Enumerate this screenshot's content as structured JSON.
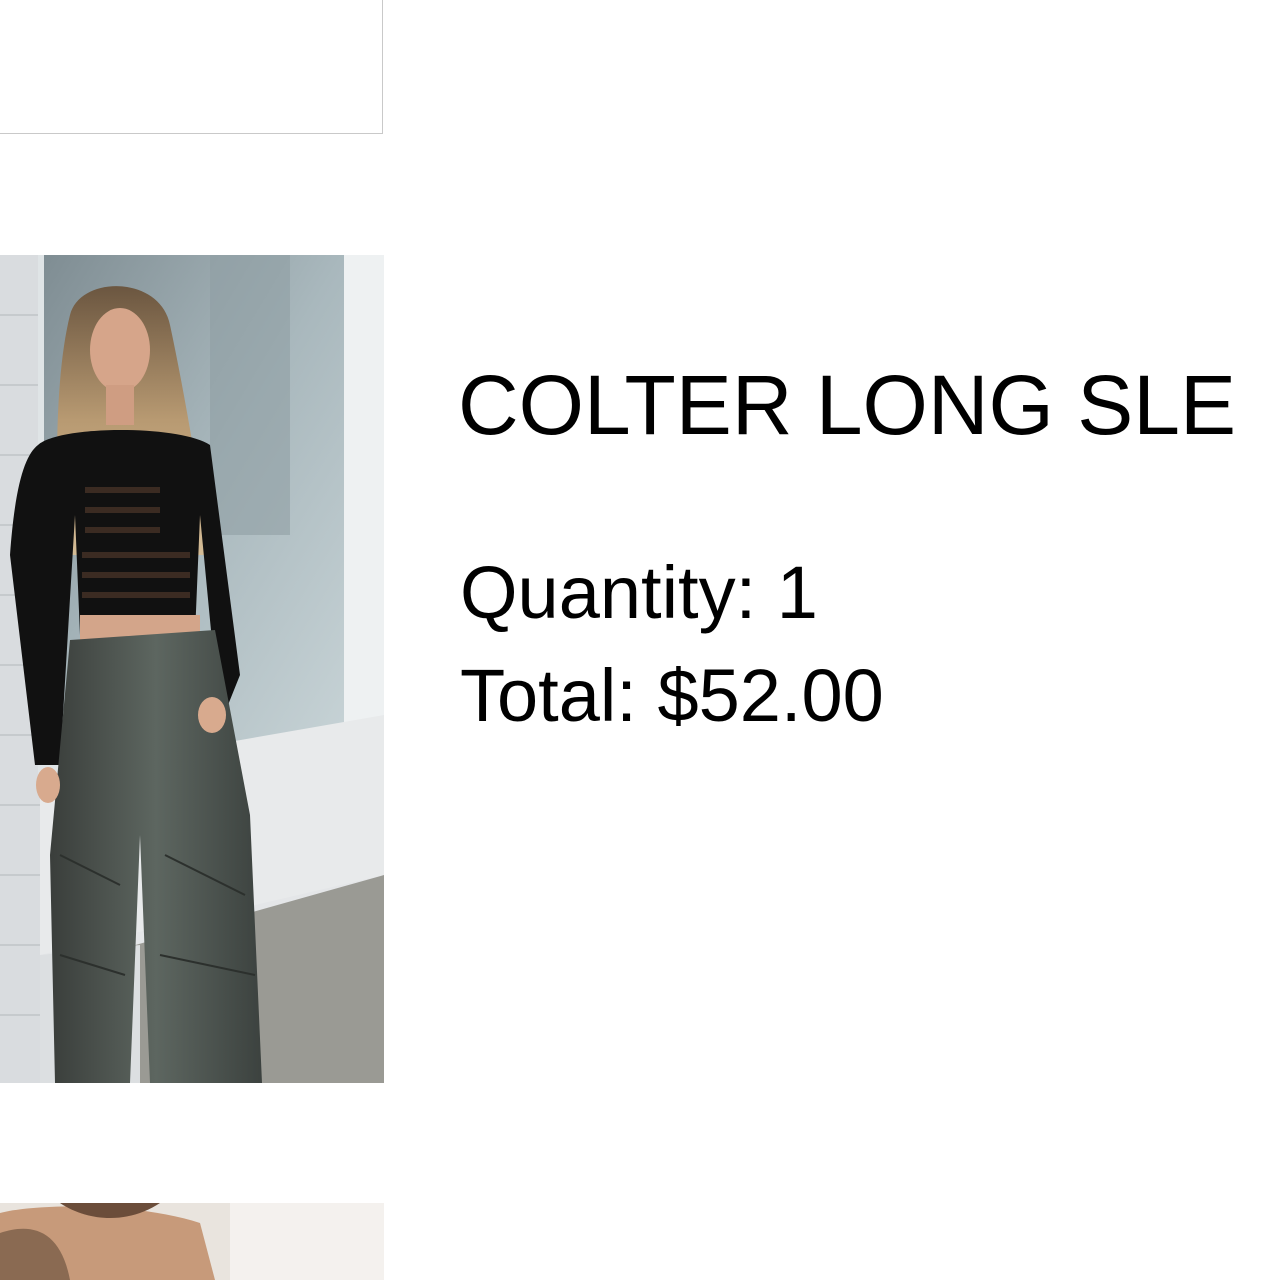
{
  "product": {
    "title": "COLTER LONG SLE",
    "quantity_label": "Quantity:",
    "quantity_value": "1",
    "total_label": "Total:",
    "total_value": "$52.00"
  },
  "images": {
    "main": "product-photo-model-black-cutout-top-wide-leg-jeans",
    "next": "product-photo-partial"
  },
  "colors": {
    "text": "#000000",
    "background": "#ffffff",
    "card_border": "#c9c9c9"
  }
}
